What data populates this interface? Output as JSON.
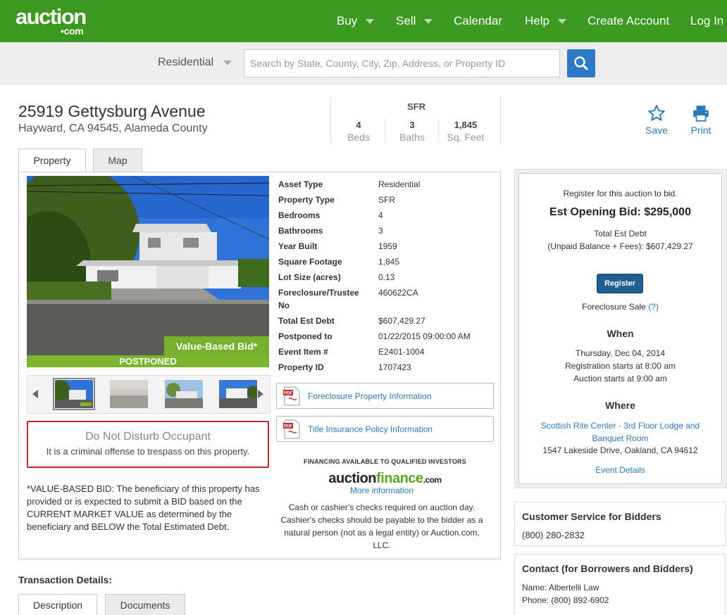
{
  "logo": {
    "line1": "auction",
    "line2": "•com"
  },
  "nav": {
    "buy": "Buy",
    "sell": "Sell",
    "calendar": "Calendar",
    "help": "Help",
    "create_account": "Create Account",
    "login": "Log In"
  },
  "search": {
    "filter": "Residential",
    "placeholder": "Search by State, County, City, Zip, Address, or Property ID"
  },
  "property": {
    "address": "25919 Gettysburg Avenue",
    "location": "Hayward, CA 94545, Alameda County",
    "type": "SFR",
    "beds": "4",
    "beds_label": "Beds",
    "baths": "3",
    "baths_label": "Baths",
    "sqft": "1,845",
    "sqft_label": "Sq. Feet"
  },
  "actions": {
    "save": "Save",
    "print": "Print"
  },
  "tabs": {
    "property": "Property",
    "map": "Map"
  },
  "photo": {
    "value_based": "Value-Based Bid*",
    "status": "POSTPONED"
  },
  "details": [
    {
      "k": "Asset Type",
      "v": "Residential"
    },
    {
      "k": "Property Type",
      "v": "SFR"
    },
    {
      "k": "Bedrooms",
      "v": "4"
    },
    {
      "k": "Bathrooms",
      "v": "3"
    },
    {
      "k": "Year Built",
      "v": "1959"
    },
    {
      "k": "Square Footage",
      "v": "1,845"
    },
    {
      "k": "Lot Size (acres)",
      "v": "0.13"
    },
    {
      "k": "Foreclosure/Trustee No",
      "v": "460622CA"
    },
    {
      "k": "Total Est Debt",
      "v": "$607,429.27"
    },
    {
      "k": "Postponed to",
      "v": "01/22/2015 09:00:00 AM"
    },
    {
      "k": "Event Item #",
      "v": "E2401-1004"
    },
    {
      "k": "Property ID",
      "v": "1707423"
    }
  ],
  "docs": {
    "foreclosure": "Foreclosure Property Information",
    "title": "Title Insurance Policy Information"
  },
  "warning": {
    "title": "Do Not Disturb Occupant",
    "text": "It is a criminal offense to trespass on this property."
  },
  "vb_note": "*VALUE-BASED BID: The beneficiary of this property has provided or is expected to submit a BID based on the CURRENT MARKET VALUE as determined by the beneficiary and BELOW the Total Estimated Debt.",
  "financing": {
    "heading": "FINANCING AVAILABLE TO QUALIFIED INVESTORS",
    "logo_a": "auction",
    "logo_b": "finance",
    "logo_c": ".com",
    "more": "More information",
    "cash": "Cash or cashier's checks required on auction day. Cashier's checks should be payable to the bidder as a natural person (not as a legal entity) or Auction.com, LLC."
  },
  "bid": {
    "register_prompt": "Register for this auction to bid.",
    "opening": "Est Opening Bid: $295,000",
    "debt_label": "Total Est Debt",
    "debt_value": "(Unpaid Balance + Fees): $607,429.27",
    "register_btn": "Register",
    "sale_type": "Foreclosure Sale",
    "help_link": "(?)",
    "when_h": "When",
    "date": "Thursday, Dec 04, 2014",
    "reg_start": "Registration starts at 8:00 am",
    "auc_start": "Auction starts at 9:00 am",
    "where_h": "Where",
    "venue": "Scottish Rite Center - 3rd Floor Lodge and Banquet Room",
    "venue_addr": "1547 Lakeside Drive, Oakland, CA 94612",
    "event_details": "Event Details"
  },
  "customer_service": {
    "title": "Customer Service for Bidders",
    "phone": "(800) 280-2832"
  },
  "contact": {
    "title": "Contact (for Borrowers and Bidders)",
    "name": "Name: Albertelli Law",
    "phone": "Phone: (800) 892-6902"
  },
  "transaction": {
    "title": "Transaction Details:",
    "tab_desc": "Description",
    "tab_docs": "Documents"
  },
  "colors": {
    "brand_green": "#3a9a1f",
    "link_blue": "#2a7ab8",
    "register_blue": "#1f5d93",
    "warning_red": "#c0272d"
  }
}
